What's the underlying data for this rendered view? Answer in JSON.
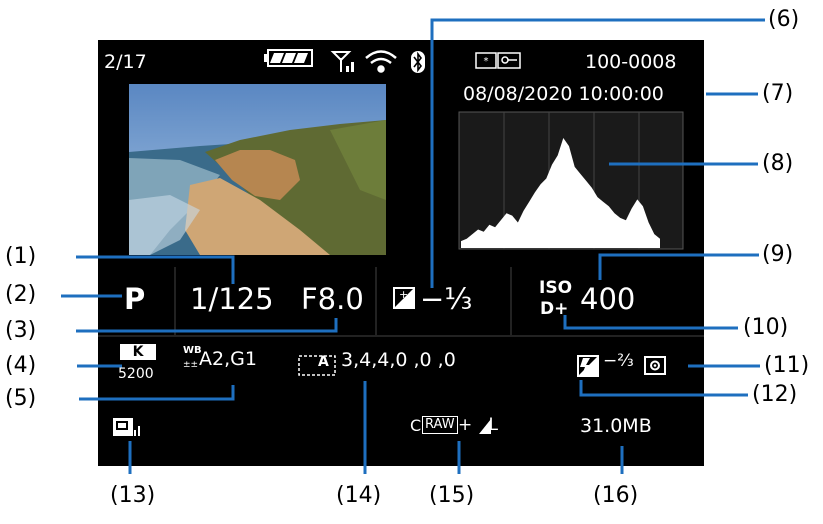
{
  "screen": {
    "image_number": "2/17",
    "folder_file": "100-0008",
    "datetime": "08/08/2020 10:00:00",
    "mode": "P",
    "shutter": "1/125",
    "aperture": "F8.0",
    "exposure_comp": "−⅓",
    "iso_label": "ISO",
    "iso": "400",
    "dplus": "D+",
    "wb_k_label": "K",
    "color_temp": "5200",
    "wb_label": "WB",
    "wb_shift": "A2,G1",
    "picture_style_badge": "A",
    "picture_style_values": "3,4,4,0 ,0 ,0",
    "flash_comp": "−⅔",
    "raw_badge": "RAW",
    "raw_prefix": "C",
    "quality_suffix": "+◢L",
    "file_size": "31.0MB"
  },
  "callouts": [
    "(1)",
    "(2)",
    "(3)",
    "(4)",
    "(5)",
    "(6)",
    "(7)",
    "(8)",
    "(9)",
    "(10)",
    "(11)",
    "(12)",
    "(13)",
    "(14)",
    "(15)",
    "(16)"
  ],
  "icons": [
    "battery-icon",
    "signal-icon",
    "wifi-icon",
    "bluetooth-icon",
    "rating-icon",
    "protect-icon",
    "exposure-comp-icon",
    "flash-comp-icon",
    "metering-icon",
    "lens-correction-icon",
    "picture-style-icon"
  ],
  "histogram": {
    "bins": [
      6,
      8,
      12,
      16,
      14,
      20,
      18,
      24,
      30,
      28,
      22,
      32,
      40,
      48,
      55,
      60,
      72,
      80,
      95,
      88,
      70,
      64,
      58,
      52,
      44,
      40,
      36,
      30,
      26,
      24,
      34,
      42,
      36,
      22,
      12,
      8
    ]
  },
  "colors": {
    "screen_bg": "#000000",
    "text": "#ffffff",
    "leader": "#1e6fbf",
    "callout": "#000000"
  }
}
